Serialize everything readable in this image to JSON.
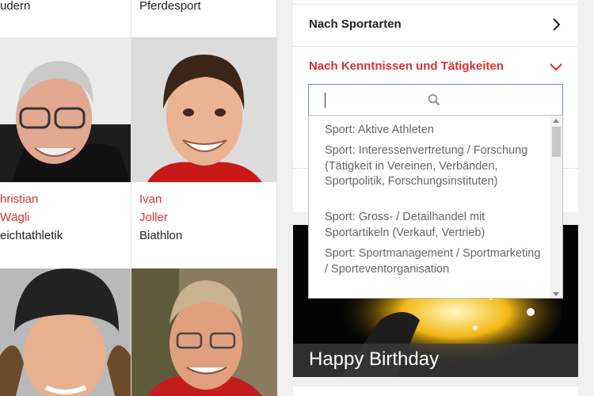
{
  "athletes": {
    "top_sports": [
      "udern",
      "Pferdesport"
    ],
    "row1": [
      {
        "first": "hristian",
        "last": "Wägli",
        "sport": "eichtathletik"
      },
      {
        "first": "Ivan",
        "last": "Joller",
        "sport": "Biathlon"
      }
    ]
  },
  "filters": {
    "sportarten_label": "Nach Sportarten",
    "kenntnisse_label": "Nach Kenntnissen und Tätigkeiten",
    "search_value": "",
    "options": [
      "Sport: Aktive Athleten",
      "Sport: Interessenvertretung / Forschung (Tätigkeit in Vereinen, Verbänden, Sportpolitik, Forschungsinstituten)",
      "Sport: Gross- / Detailhandel mit Sportartikeln (Verkauf, Vertrieb)",
      "Sport: Sportmanagement / Sportmarketing / Sporteventorganisation"
    ]
  },
  "birthday": {
    "title": "Happy Birthday"
  },
  "colors": {
    "accent": "#d8322e",
    "focus_border": "#5b8fd6"
  }
}
